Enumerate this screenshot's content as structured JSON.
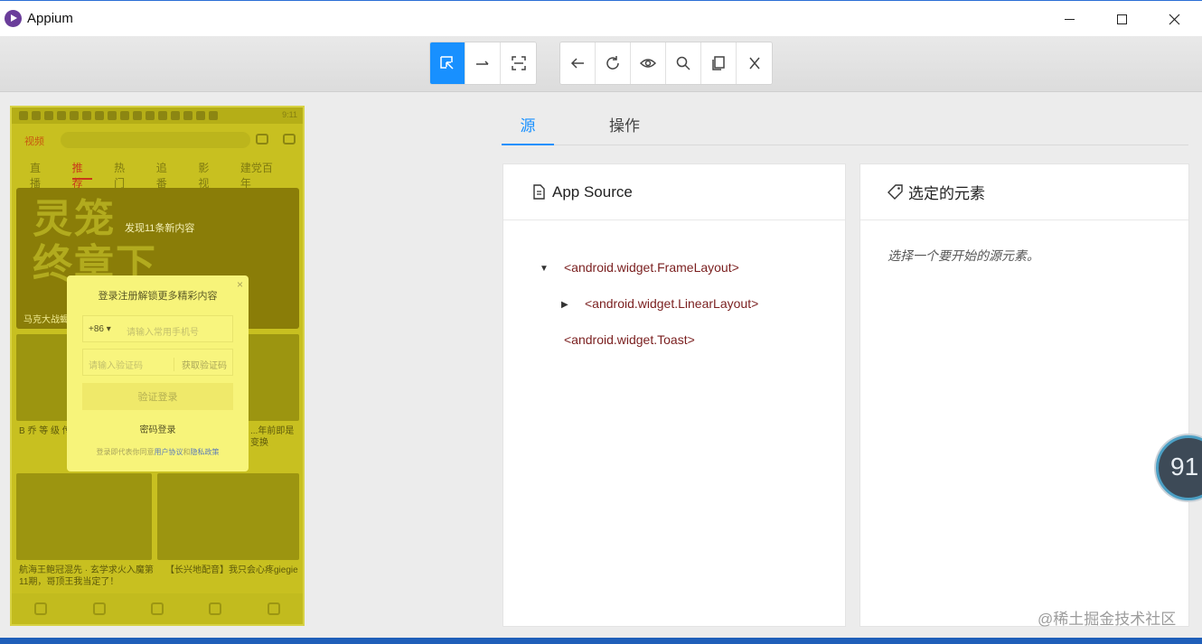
{
  "window": {
    "title": "Appium"
  },
  "device": {
    "time": "9:11",
    "logo_text": "视频",
    "tabs": [
      "直播",
      "推荐",
      "热门",
      "追番",
      "影视",
      "建党百年"
    ],
    "banner_big": "灵笼\n终章下",
    "banner_note": "发现11条新内容",
    "banner_caption": "马克大战蝎...",
    "card1_caption": "B 乔 等 级 传...",
    "card2_caption": "...年前即是\n变换",
    "card3_caption": "航海王鲍冠混先 · 玄学求火入魔第\n11期，哥顶王我当定了！",
    "card4_caption": "【长兴地配音】我只会心疼giegie",
    "dialog": {
      "close": "×",
      "title": "登录注册解锁更多精彩内容",
      "country_code": "+86 ▾",
      "phone_placeholder": "请输入常用手机号",
      "code_placeholder": "请输入验证码",
      "get_code": "获取验证码",
      "verify_login": "验证登录",
      "password_login": "密码登录",
      "agreement_prefix": "登录即代表你同意",
      "agreement_user": "用户协议",
      "agreement_and": "和",
      "agreement_privacy": "隐私政策"
    }
  },
  "tabs": {
    "source": "源",
    "actions": "操作"
  },
  "source_panel": {
    "title": "App Source",
    "tree": [
      {
        "label": "<android.widget.FrameLayout>",
        "caret": "▼"
      },
      {
        "label": "<android.widget.LinearLayout>",
        "caret": "▶"
      },
      {
        "label": "<android.widget.Toast>",
        "caret": ""
      }
    ]
  },
  "selected_panel": {
    "title": "选定的元素",
    "hint": "选择一个要开始的源元素。"
  },
  "overlay": {
    "perf_value": "91",
    "watermark": "@稀土掘金技术社区"
  },
  "colors": {
    "accent": "#1890ff",
    "highlight": "#f7f47a",
    "tree_text": "#7a1f1f"
  }
}
